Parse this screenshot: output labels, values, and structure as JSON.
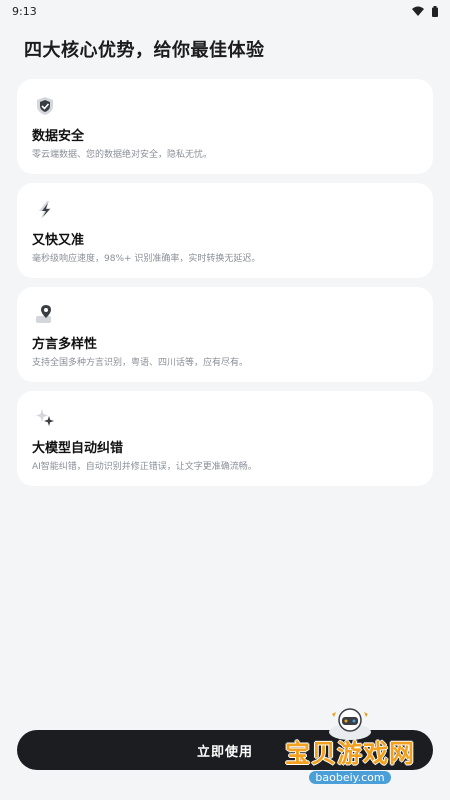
{
  "status_bar": {
    "time": "9:13",
    "icons": [
      "wifi-icon",
      "battery-icon"
    ]
  },
  "page": {
    "title": "四大核心优势，给你最佳体验"
  },
  "features": [
    {
      "icon": "shield-icon",
      "title": "数据安全",
      "desc": "零云端数据、您的数据绝对安全，隐私无忧。"
    },
    {
      "icon": "lightning-icon",
      "title": "又快又准",
      "desc": "毫秒级响应速度，98%+ 识别准确率，实时转换无延迟。"
    },
    {
      "icon": "map-pin-icon",
      "title": "方言多样性",
      "desc": "支持全国多种方言识别，粤语、四川话等，应有尽有。"
    },
    {
      "icon": "sparkle-icon",
      "title": "大模型自动纠错",
      "desc": "AI智能纠错，自动识别并修正错误，让文字更准确流畅。"
    }
  ],
  "primary_button": {
    "label": "立即使用"
  },
  "watermark": {
    "main": "宝贝游戏网",
    "sub": "baobeiy.com"
  },
  "colors": {
    "background": "#f4f5f7",
    "card": "#ffffff",
    "button": "#1b1d20",
    "desc_text": "#8a8f98",
    "watermark_orange": "#f2a020",
    "watermark_blue": "#4a9fd8"
  }
}
